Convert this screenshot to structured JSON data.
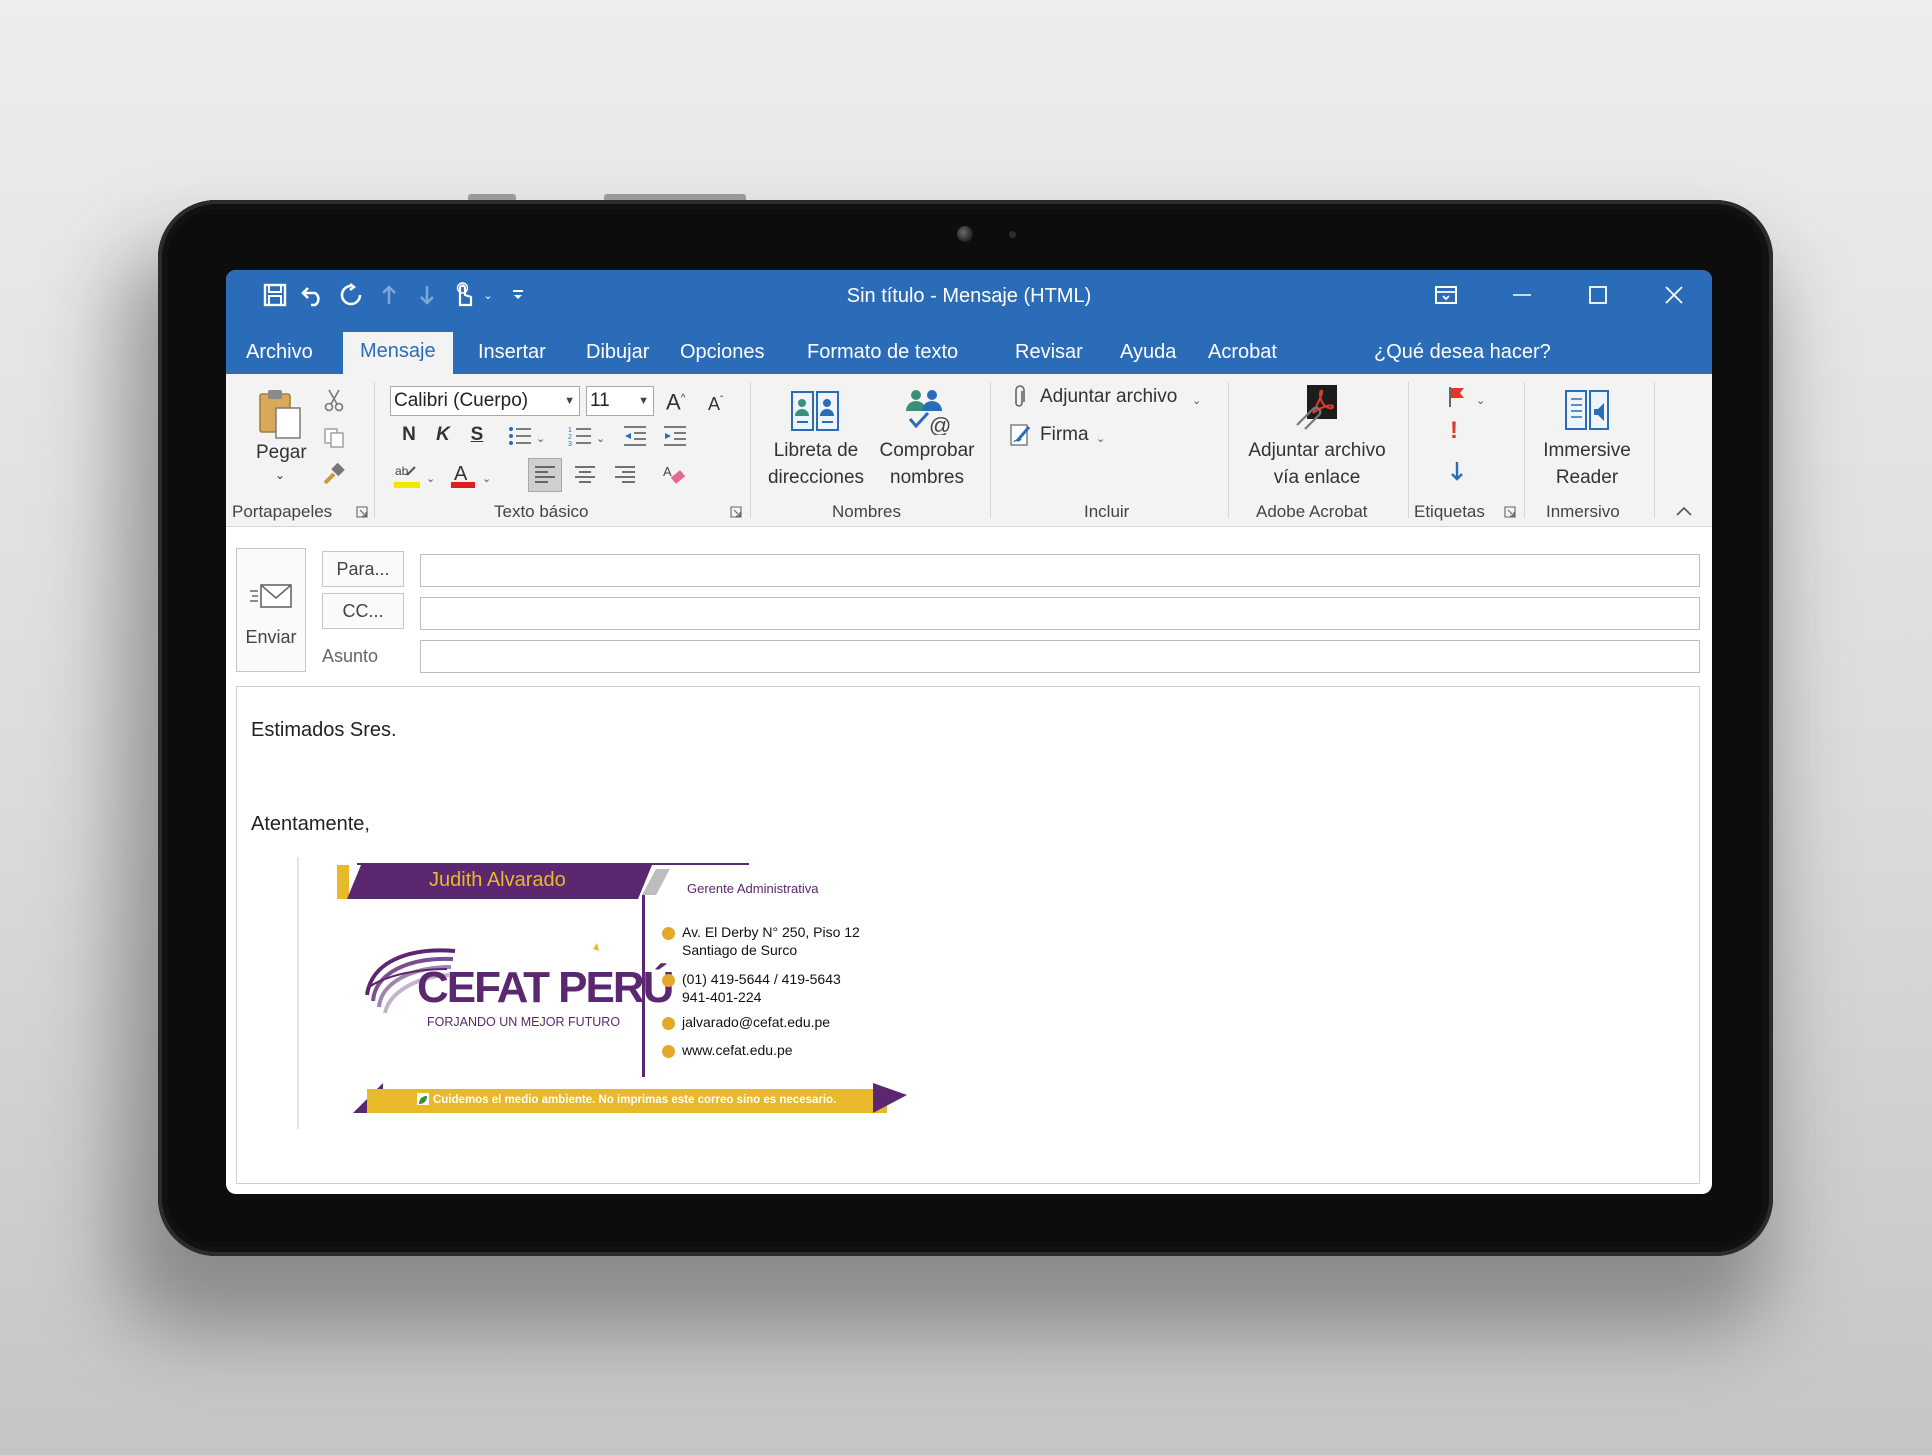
{
  "window": {
    "title": "Sin título  -  Mensaje (HTML)"
  },
  "tabs": [
    {
      "label": "Archivo"
    },
    {
      "label": "Mensaje"
    },
    {
      "label": "Insertar"
    },
    {
      "label": "Dibujar"
    },
    {
      "label": "Opciones"
    },
    {
      "label": "Formato de texto"
    },
    {
      "label": "Revisar"
    },
    {
      "label": "Ayuda"
    },
    {
      "label": "Acrobat"
    },
    {
      "label": "¿Qué desea hacer?"
    }
  ],
  "ribbon": {
    "clipboard": {
      "paste_label": "Pegar",
      "group_label": "Portapapeles"
    },
    "basic_text": {
      "font_name": "Calibri (Cuerpo)",
      "font_size": "11",
      "bold": "N",
      "italic": "K",
      "underline": "S",
      "group_label": "Texto básico"
    },
    "names": {
      "address_book_line1": "Libreta de",
      "address_book_line2": "direcciones",
      "check_names_line1": "Comprobar",
      "check_names_line2": "nombres",
      "group_label": "Nombres"
    },
    "include": {
      "attach_file": "Adjuntar archivo",
      "signature": "Firma",
      "group_label": "Incluir"
    },
    "adobe": {
      "attach_link_line1": "Adjuntar archivo",
      "attach_link_line2": "vía enlace",
      "group_label": "Adobe Acrobat"
    },
    "tags": {
      "group_label": "Etiquetas"
    },
    "immersive": {
      "line1": "Immersive",
      "line2": "Reader",
      "group_label": "Inmersivo"
    }
  },
  "compose": {
    "send_label": "Enviar",
    "to_label": "Para...",
    "cc_label": "CC...",
    "subject_label": "Asunto",
    "to_value": "",
    "cc_value": "",
    "subject_value": ""
  },
  "body": {
    "greeting": "Estimados Sres.",
    "closing": "Atentamente,"
  },
  "signature": {
    "name": "Judith Alvarado",
    "role": "Gerente Administrativa",
    "logo_text": "CEFAT PERÚ",
    "logo_tagline": "FORJANDO UN MEJOR FUTURO",
    "address_line1": "Av. El Derby N° 250, Piso 12",
    "address_line2": "Santiago de Surco",
    "phone_line1": "(01) 419-5644 / 419-5643",
    "phone_line2": "941-401-224",
    "email": "jalvarado@cefat.edu.pe",
    "website": "www.cefat.edu.pe",
    "footer": "Cuidemos el medio ambiente. No imprimas este correo sino es necesario."
  },
  "colors": {
    "titlebar": "#2b6cb8",
    "brand_purple": "#5b2770",
    "brand_gold": "#e8b92a"
  }
}
